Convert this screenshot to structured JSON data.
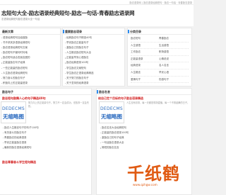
{
  "topbar": {
    "links": "励志语录网 | 励志语录经典短句 · 励志一句话 · 青春励志语录"
  },
  "header": {
    "title": "志短句大全-励志语录经典短句-励志一句话-青春励志语录网",
    "subtitle": "志语录经典短句励志语录大全一句话"
  },
  "new_section": {
    "title": "最新文章",
    "items": [
      "语录经典短句加油鼓励",
      "书不求其多语录经典短句",
      "励志语录经典短句文案",
      "励志短句不管何时何地",
      "励志短句适合发朋友圈的",
      "正能量励志句子经典",
      "一些正能量的励志短句",
      "人生励志语录经典短句",
      "努力奋斗的励志句子",
      "积极向上的正能量语录",
      "一句话励志语录简短",
      "青春励志语录经典句子"
    ]
  },
  "rec_section": {
    "title": "重要励志语录",
    "items": [
      "经典励志句子精选40句",
      "早安励志正能量句子",
      "激励自己的励志句子",
      "人生格言励志短句大全",
      "正能量早安心语励志",
      "励志经典语录100句",
      "学生励志文案短句",
      "学生励志正语录经典精选",
      "关于努力的励志句子",
      "关于坚持的经典语录",
      "有意义的励志句子",
      "有关青春的励志名言"
    ]
  },
  "cat_section": {
    "title": "分类目录",
    "items": [
      {
        "left": "励志短句",
        "right": "青春励志"
      },
      {
        "left": "人生感悟",
        "right": "生活感悟"
      },
      {
        "left": "工作励志",
        "right": "职场感悟"
      },
      {
        "left": "正能量语录",
        "right": "心情说说"
      },
      {
        "left": "经典语录",
        "right": "名人名言"
      },
      {
        "left": "人生格言",
        "right": "早安心语"
      },
      {
        "left": "爱情句子",
        "right": "伤感句子"
      },
      {
        "left": "友情句子",
        "right": "晚安心语"
      },
      {
        "left": "毕业句子",
        "right": "哲理句子"
      }
    ]
  },
  "lower_left": {
    "title": "励志句子"
  },
  "lower_right": {
    "title": "励志名言"
  },
  "feature_a": {
    "title": "励志短句鼓舞人心的句子精选40句",
    "thumb_line1": "DEDECMS",
    "thumb_line2": "无缩略图",
    "desc": "努力向上的正能量句子。努力不一定会成功，但放弃一定会失败。"
  },
  "feature_b": {
    "title": "给自己定个目标的句子励志语录精选",
    "thumb_line1": "DEDECMS",
    "thumb_line2": "无缩略图",
    "desc": "人生没有彩排，每一天都是现场直播。每一个不曾起舞的日子。"
  },
  "list_a": {
    "items": [
      "励志人生格言句子的句子100句",
      "有关奋斗的励志句子",
      "青春励志的经典语录",
      "早安正能量励志语录",
      "最新的励志语录经典短句"
    ]
  },
  "list_b": {
    "items": [
      "励志名言大全经典短句",
      "正能量的励志语录100句",
      "激励自己的句子经典",
      "一句话励志语录大全",
      "简短的励志名言"
    ]
  },
  "extra": {
    "title": "励志青春奋斗学生短句精选"
  },
  "watermark": {
    "text": "千纸鹤",
    "url": "www.qzhgw.com"
  }
}
